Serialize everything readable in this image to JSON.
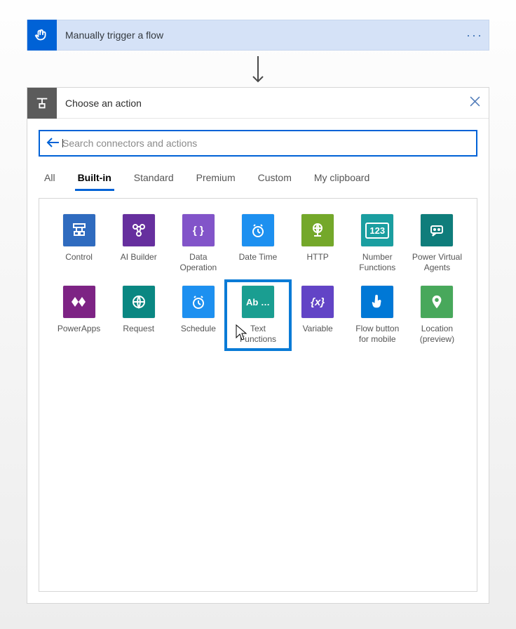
{
  "trigger": {
    "title": "Manually trigger a flow"
  },
  "action": {
    "title": "Choose an action",
    "searchPlaceholder": "Search connectors and actions"
  },
  "tabs": {
    "t0": "All",
    "t1": "Built-in",
    "t2": "Standard",
    "t3": "Premium",
    "t4": "Custom",
    "t5": "My clipboard",
    "active": "Built-in"
  },
  "connectors": {
    "control": {
      "label": "Control",
      "bg": "#2f6bbf"
    },
    "aibuilder": {
      "label": "AI Builder",
      "bg": "#662f9e"
    },
    "dataop": {
      "label": "Data\nOperation",
      "bg": "#8254c9"
    },
    "datetime": {
      "label": "Date Time",
      "bg": "#1d90f0"
    },
    "http": {
      "label": "HTTP",
      "bg": "#74a82a"
    },
    "numberfn": {
      "label": "Number\nFunctions",
      "bg": "#1a9ea0"
    },
    "pva": {
      "label": "Power Virtual\nAgents",
      "bg": "#0f7d7b"
    },
    "powerapps": {
      "label": "PowerApps",
      "bg": "#7d2384"
    },
    "request": {
      "label": "Request",
      "bg": "#0a8782"
    },
    "schedule": {
      "label": "Schedule",
      "bg": "#1d90f0"
    },
    "textfn": {
      "label": "Text\nFunctions",
      "bg": "#1a9e91"
    },
    "variable": {
      "label": "Variable",
      "bg": "#6244c6"
    },
    "flowbtn": {
      "label": "Flow button\nfor mobile",
      "bg": "#0078d6"
    },
    "location": {
      "label": "Location\n(preview)",
      "bg": "#48a85b"
    }
  },
  "highlighted": "textfn"
}
